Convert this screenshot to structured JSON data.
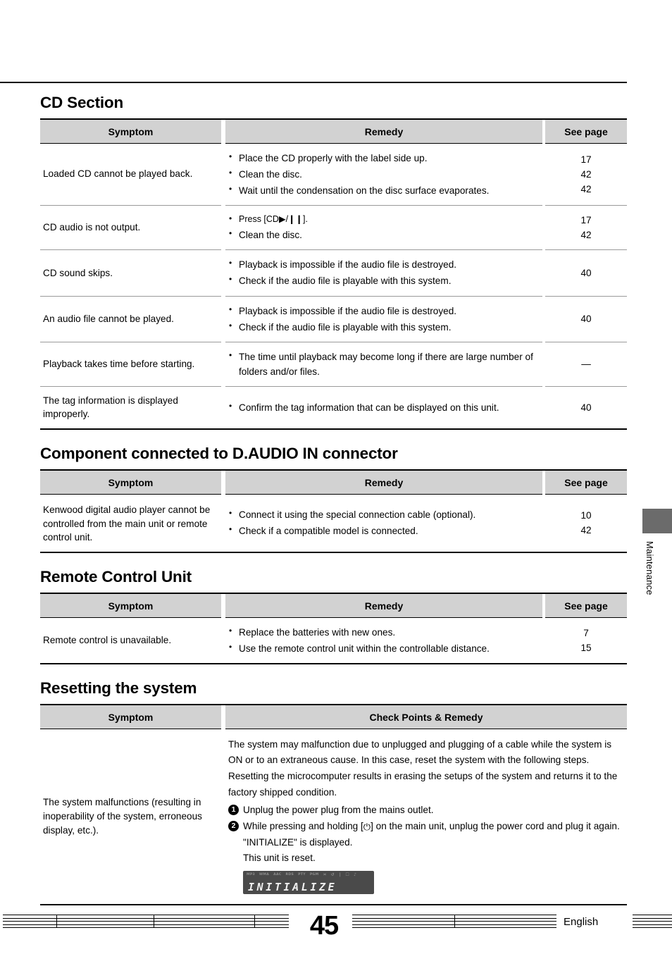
{
  "page": {
    "number": "45",
    "language": "English",
    "side_tab_label": "Maintenance"
  },
  "sections": [
    {
      "id": "cd-section",
      "title": "CD Section",
      "headers": {
        "symptom": "Symptom",
        "remedy": "Remedy",
        "see_page": "See page"
      },
      "rows": [
        {
          "symptom": "Loaded CD cannot be played back.",
          "remedies": [
            "Place the CD properly with the label side up.",
            "Clean the disc.",
            "Wait until the condensation on the disc surface evaporates."
          ],
          "pages": [
            "17",
            "42",
            "42"
          ]
        },
        {
          "symptom": "CD audio is not output.",
          "remedies": [
            "Press [CD▶/❙❙].",
            "Clean the disc."
          ],
          "pages": [
            "17",
            "42"
          ]
        },
        {
          "symptom": "CD sound skips.",
          "remedies": [
            "Playback is impossible if the audio file is destroyed.",
            "Check if the audio file is playable with this system."
          ],
          "pages": [
            "40"
          ]
        },
        {
          "symptom": "An audio file cannot be played.",
          "remedies": [
            "Playback is impossible if the audio file is destroyed.",
            "Check if the audio file is playable with this system."
          ],
          "pages": [
            "40"
          ]
        },
        {
          "symptom": "Playback takes time before starting.",
          "remedies": [
            "The time until playback may become long if there are large number of folders and/or files."
          ],
          "pages": [
            "—"
          ]
        },
        {
          "symptom": "The tag information is displayed improperly.",
          "remedies": [
            "Confirm the tag information that can be displayed on this unit."
          ],
          "pages": [
            "40"
          ]
        }
      ]
    },
    {
      "id": "daudio-section",
      "title": "Component connected to D.AUDIO IN connector",
      "headers": {
        "symptom": "Symptom",
        "remedy": "Remedy",
        "see_page": "See page"
      },
      "rows": [
        {
          "symptom": "Kenwood digital audio player cannot be controlled from the main unit or remote control unit.",
          "remedies": [
            "Connect it using the special connection cable (optional).",
            "Check if a compatible model is connected."
          ],
          "pages": [
            "10",
            "42"
          ]
        }
      ]
    },
    {
      "id": "remote-section",
      "title": "Remote Control Unit",
      "headers": {
        "symptom": "Symptom",
        "remedy": "Remedy",
        "see_page": "See page"
      },
      "rows": [
        {
          "symptom": "Remote control is unavailable.",
          "remedies": [
            "Replace the batteries with new ones.",
            "Use the remote control unit within the controllable distance."
          ],
          "pages": [
            "7",
            "15"
          ]
        }
      ]
    }
  ],
  "reset_section": {
    "title": "Resetting the system",
    "headers": {
      "symptom": "Symptom",
      "check_points": "Check Points & Remedy"
    },
    "symptom": "The system malfunctions (resulting in inoperability of the system, erroneous display, etc.).",
    "intro": "The system may malfunction due to unplugged and plugging of a cable while the system is ON or to an extraneous cause. In this case, reset the system with the following steps. Resetting the microcomputer results in erasing the setups of the system and returns it to the factory shipped condition.",
    "steps": [
      {
        "num": "1",
        "text": "Unplug the power plug from the mains outlet."
      },
      {
        "num": "2",
        "text_before": "While pressing and holding [",
        "text_after": "] on the main unit, unplug the power cord and plug it again."
      }
    ],
    "sub_lines": [
      "\"INITIALIZE\" is displayed.",
      "This unit is reset."
    ],
    "lcd": {
      "indicators": [
        "MP3",
        "WMA",
        "AAC",
        "RDS",
        "PTY",
        "PGM"
      ],
      "icons": [
        "shuffle-icon",
        "repeat-icon",
        "bar-icon",
        "folder-icon",
        "note-icon"
      ],
      "text": "INITIALIZE"
    }
  }
}
